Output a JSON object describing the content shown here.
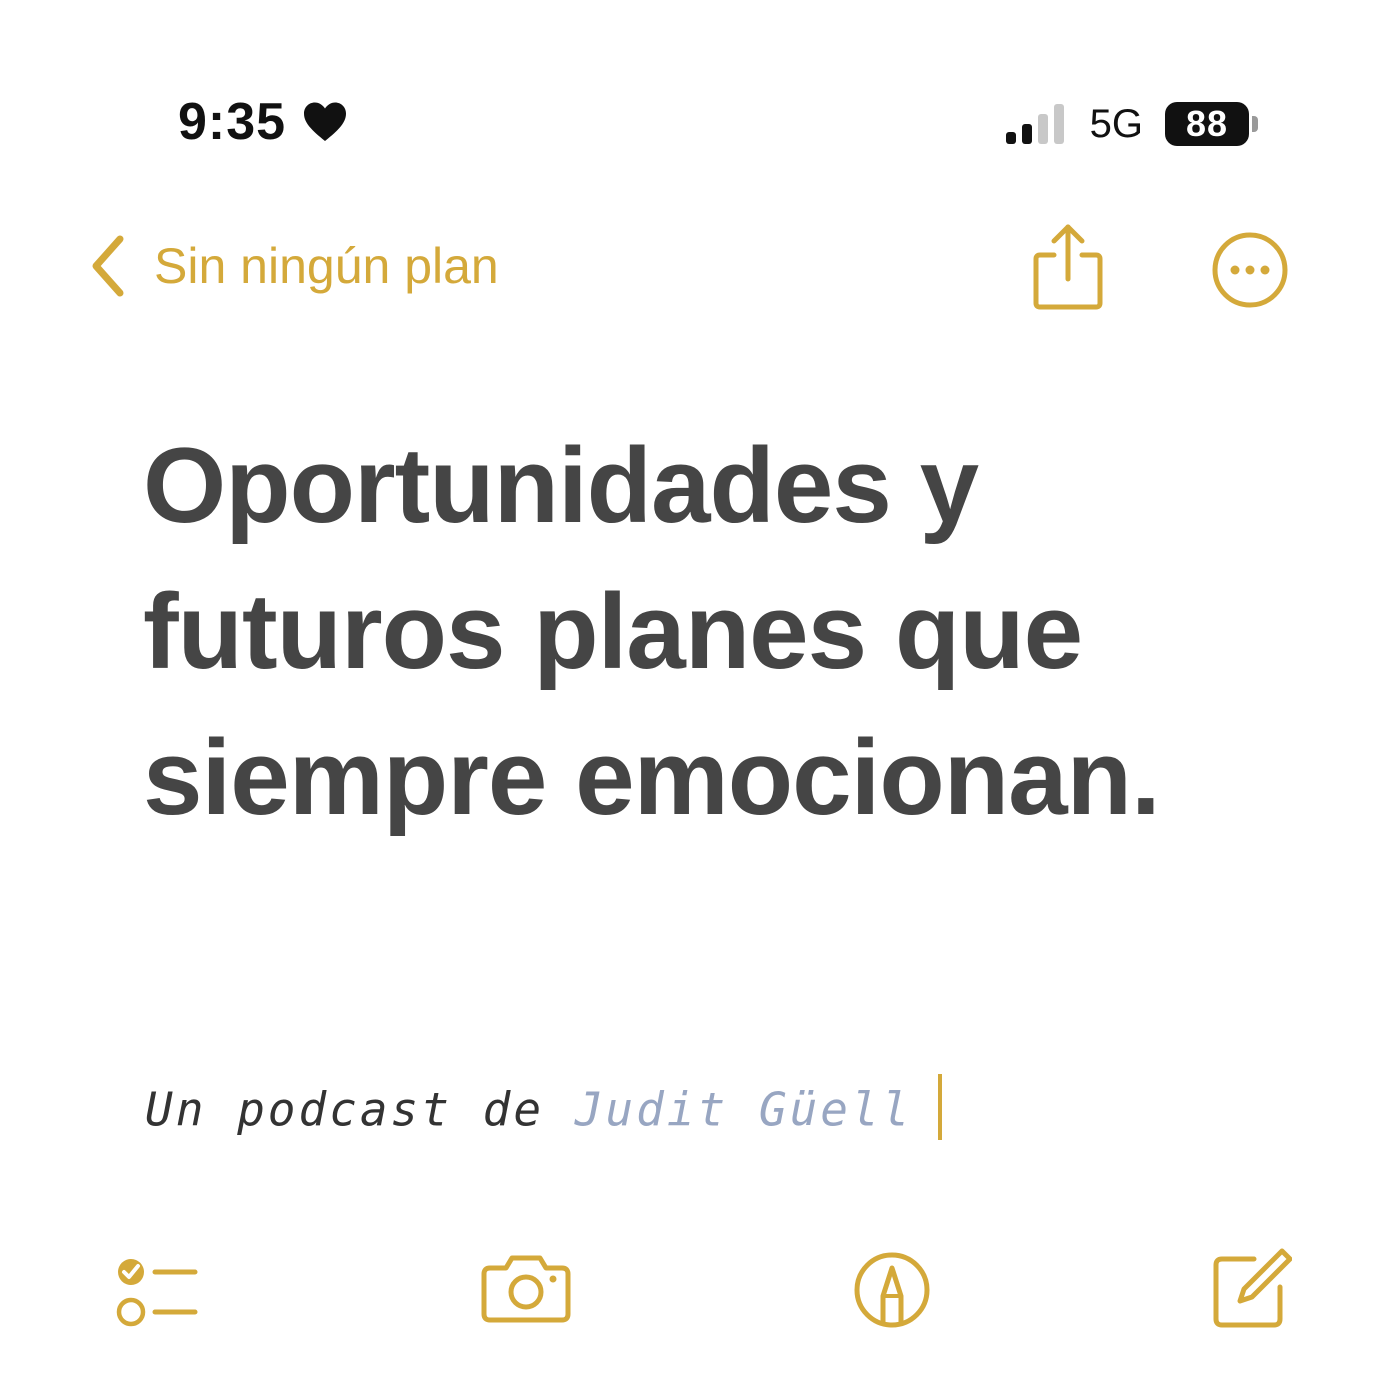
{
  "status_bar": {
    "time": "9:35",
    "network": "5G",
    "battery": "88",
    "icons": [
      "heart-icon",
      "signal-icon",
      "battery-icon"
    ]
  },
  "nav": {
    "back_label": "Sin ningún plan",
    "icons": [
      "chevron-left-icon",
      "share-icon",
      "more-icon"
    ]
  },
  "note": {
    "title_lines": [
      "Oportunidades y",
      "futuros planes que",
      "siempre emocionan."
    ],
    "subtitle_prefix": "Un podcast de ",
    "author": "Judit Güell"
  },
  "toolbar": {
    "icons": [
      "checklist-icon",
      "camera-icon",
      "markup-icon",
      "compose-icon"
    ]
  },
  "colors": {
    "accent": "#D4A93A",
    "title": "#454545",
    "author": "#98A6C2",
    "background": "#FFFFFF"
  }
}
